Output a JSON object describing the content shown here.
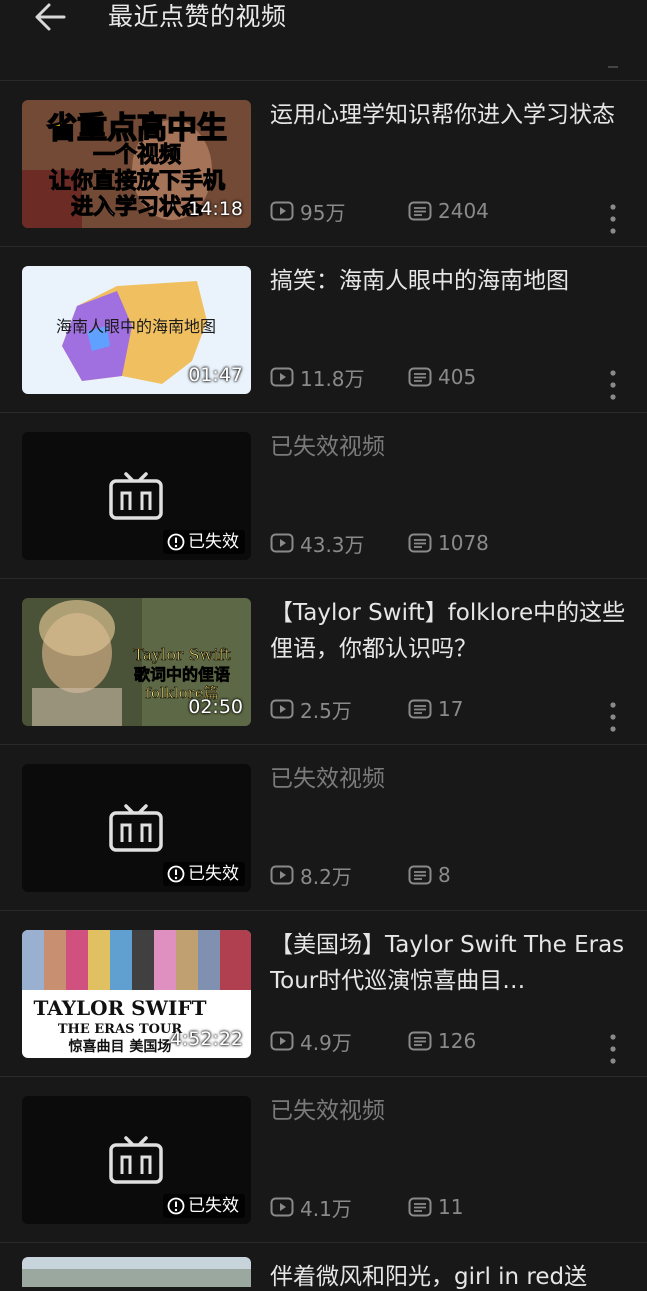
{
  "header": {
    "title": "最近点赞的视频"
  },
  "videos": [
    {
      "title": "运用心理学知识帮你进入学习状态",
      "duration": "14:18",
      "plays": "95万",
      "danmaku": "2404",
      "invalid": false,
      "thumb_text": [
        "省重点高中生",
        "一个视频",
        "让你直接放下手机",
        "进入学习状态"
      ]
    },
    {
      "title": "搞笑：海南人眼中的海南地图",
      "duration": "01:47",
      "plays": "11.8万",
      "danmaku": "405",
      "invalid": false,
      "thumb_text": [
        "海南人眼中的海南地图"
      ]
    },
    {
      "title": "已失效视频",
      "badge": "已失效",
      "plays": "43.3万",
      "danmaku": "1078",
      "invalid": true
    },
    {
      "title": "【Taylor Swift】folklore中的这些俚语，你都认识吗？",
      "duration": "02:50",
      "plays": "2.5万",
      "danmaku": "17",
      "invalid": false,
      "thumb_text": [
        "Taylor Swift",
        "歌词中的俚语",
        "folklore篇"
      ]
    },
    {
      "title": "已失效视频",
      "badge": "已失效",
      "plays": "8.2万",
      "danmaku": "8",
      "invalid": true
    },
    {
      "title": "【美国场】Taylor Swift The Eras Tour时代巡演惊喜曲目…",
      "duration": "4:52:22",
      "plays": "4.9万",
      "danmaku": "126",
      "invalid": false,
      "thumb_text": [
        "TAYLOR SWIFT",
        "THE ERAS TOUR",
        "惊喜曲目 美国场"
      ]
    },
    {
      "title": "已失效视频",
      "badge": "已失效",
      "plays": "4.1万",
      "danmaku": "11",
      "invalid": true
    }
  ],
  "partial_item": {
    "title": "伴着微风和阳光，girl in red送"
  },
  "colors": {
    "background": "#181818",
    "text": "#e6e6e6",
    "muted": "#8a8a8a",
    "invalid_title": "#7a7a7a"
  },
  "icons": {
    "back": "arrow-left-icon",
    "play": "play-icon",
    "danmaku": "danmaku-icon",
    "more": "more-vertical-icon",
    "tv": "tv-icon",
    "warning": "warning-circle-icon"
  }
}
